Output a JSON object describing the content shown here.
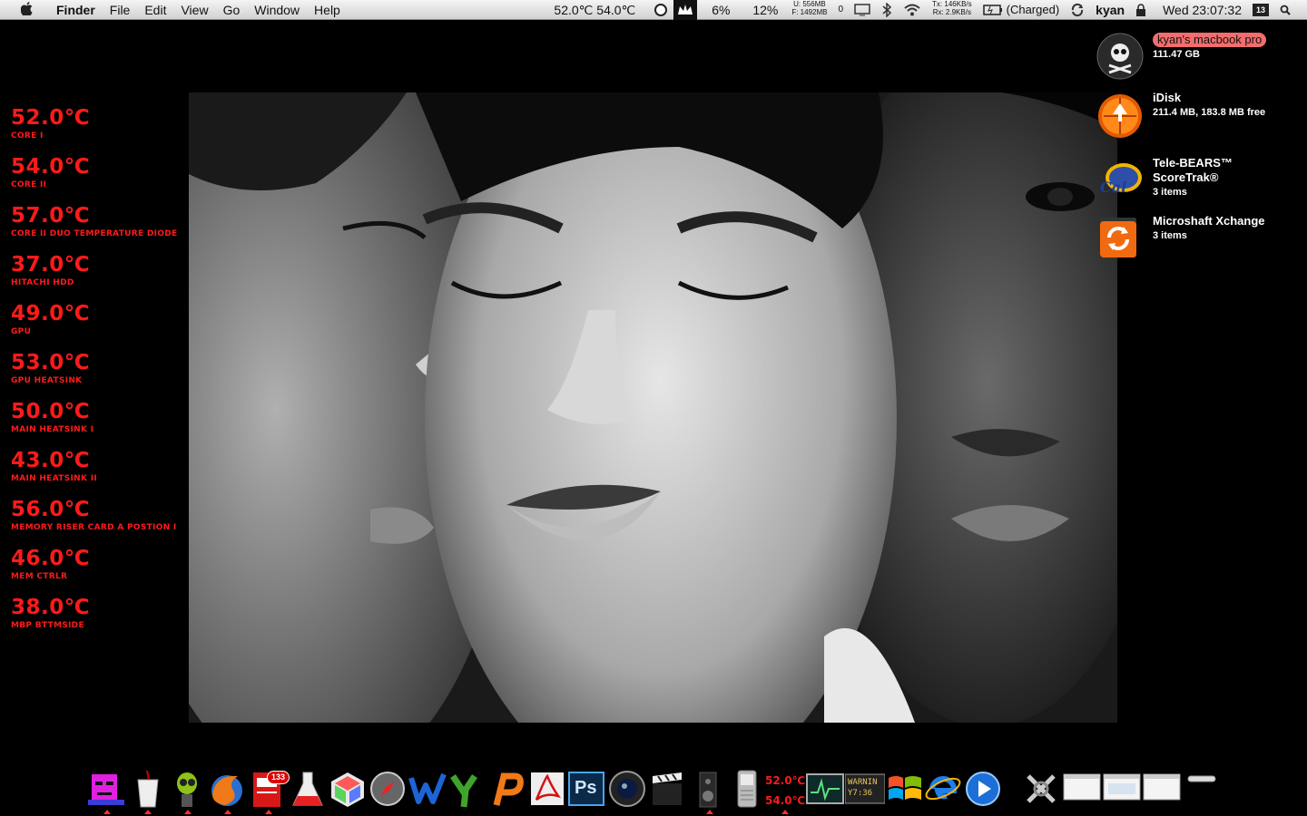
{
  "menubar": {
    "app_name": "Finder",
    "menus": [
      "File",
      "Edit",
      "View",
      "Go",
      "Window",
      "Help"
    ],
    "temps": "52.0℃ 54.0℃",
    "cpu1": "6%",
    "cpu2": "12%",
    "mem_used": "U:   556MB",
    "mem_free": "F: 1492MB",
    "mem_count": "0",
    "net_tx": "Tx:  146KB/s",
    "net_rx": "Rx:   2.9KB/s",
    "battery": "(Charged)",
    "user": "kyan",
    "clock": "Wed 23:07:32",
    "calendar_day": "13"
  },
  "temperatures": [
    {
      "value": "52.0℃",
      "label": "Core I"
    },
    {
      "value": "54.0℃",
      "label": "Core II"
    },
    {
      "value": "57.0℃",
      "label": "Core II Duo Temperature Diode"
    },
    {
      "value": "37.0℃",
      "label": "Hitachi HDD"
    },
    {
      "value": "49.0℃",
      "label": "GPU"
    },
    {
      "value": "53.0℃",
      "label": "GPU Heatsink"
    },
    {
      "value": "50.0℃",
      "label": "Main Heatsink I"
    },
    {
      "value": "43.0℃",
      "label": "Main Heatsink II"
    },
    {
      "value": "56.0℃",
      "label": "Memory Riser Card A Postion I"
    },
    {
      "value": "46.0℃",
      "label": "Mem Ctrlr"
    },
    {
      "value": "38.0℃",
      "label": "MBP Bttmside"
    }
  ],
  "desktop": {
    "hd": {
      "name": "kyan's macbook pro",
      "info": "111.47 GB"
    },
    "idisk": {
      "name": "iDisk",
      "info": "211.4 MB, 183.8 MB free"
    },
    "telebears": {
      "name1": "Tele-BEARS™",
      "name2": "ScoreTrak®",
      "info": "3 items"
    },
    "xchange": {
      "name": "Microshaft Xchange",
      "info": "3 items"
    }
  },
  "dock": {
    "mail_badge": "133",
    "temp1": "52.0℃",
    "temp2": "54.0℃",
    "ps_label": "Ps",
    "warning_text": "WARNIN",
    "warning_sub": "Y7:36"
  },
  "colors": {
    "accent_red": "#ff1a1a",
    "hd_label": "#f26d6d"
  }
}
